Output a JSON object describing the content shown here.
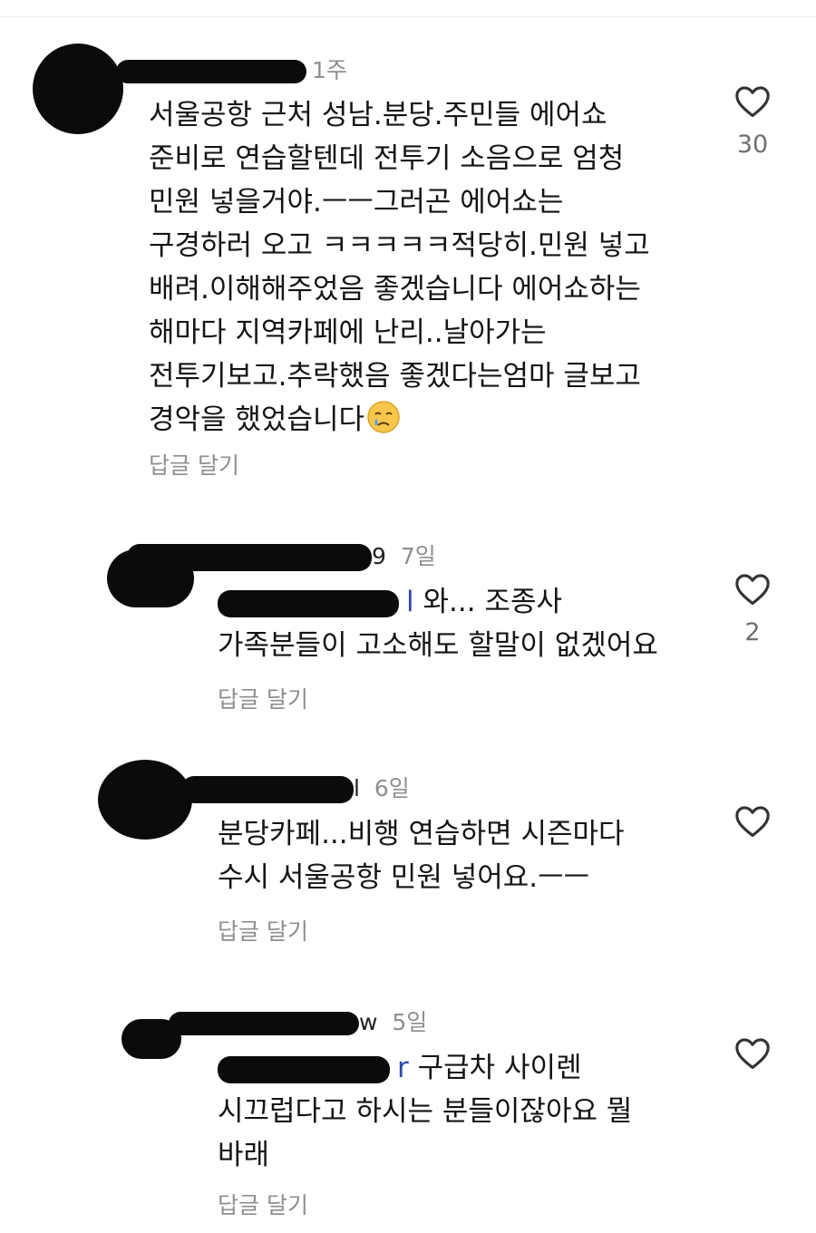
{
  "comments": [
    {
      "time": "1주",
      "lines": [
        "서울공항 근처 성남.분당.주민들 에어쇼",
        "준비로 연습할텐데 전투기 소음으로 엄청",
        "민원 넣을거야.ㅡㅡ그러곤 에어쇼는",
        "구경하러 오고 ㅋㅋㅋㅋㅋ적당히.민원 넣고",
        "배려.이해해주었음 좋겠습니다 에어쇼하는",
        "해마다 지역카페에 난리..날아가는",
        "전투기보고.추락했음 좋겠다는엄마 글보고",
        "경악을 했었습니다"
      ],
      "emoji": "crying-face-emoji",
      "reply_label": "답글 달기",
      "likes": "30"
    },
    {
      "user_suffix": "9",
      "time": "7일",
      "mention_suffix": "l",
      "lines": [
        "와... 조종사",
        "가족분들이 고소해도 할말이 없겠어요"
      ],
      "reply_label": "답글 달기",
      "likes": "2"
    },
    {
      "user_suffix": "l",
      "time": "6일",
      "lines": [
        "분당카페...비행 연습하면 시즌마다",
        "수시 서울공항 민원 넣어요.ㅡㅡ"
      ],
      "reply_label": "답글 달기",
      "likes": ""
    },
    {
      "user_suffix": "w",
      "time": "5일",
      "mention_suffix": "r",
      "lines": [
        "구급차 사이렌",
        "시끄럽다고 하시는 분들이잖아요 뭘",
        "바래"
      ],
      "reply_label": "답글 달기",
      "likes": ""
    }
  ],
  "icons": {
    "like": "heart-outline-icon"
  },
  "colors": {
    "text": "#141414",
    "muted": "#8e8e8e",
    "redaction": "#0b0b0b"
  }
}
